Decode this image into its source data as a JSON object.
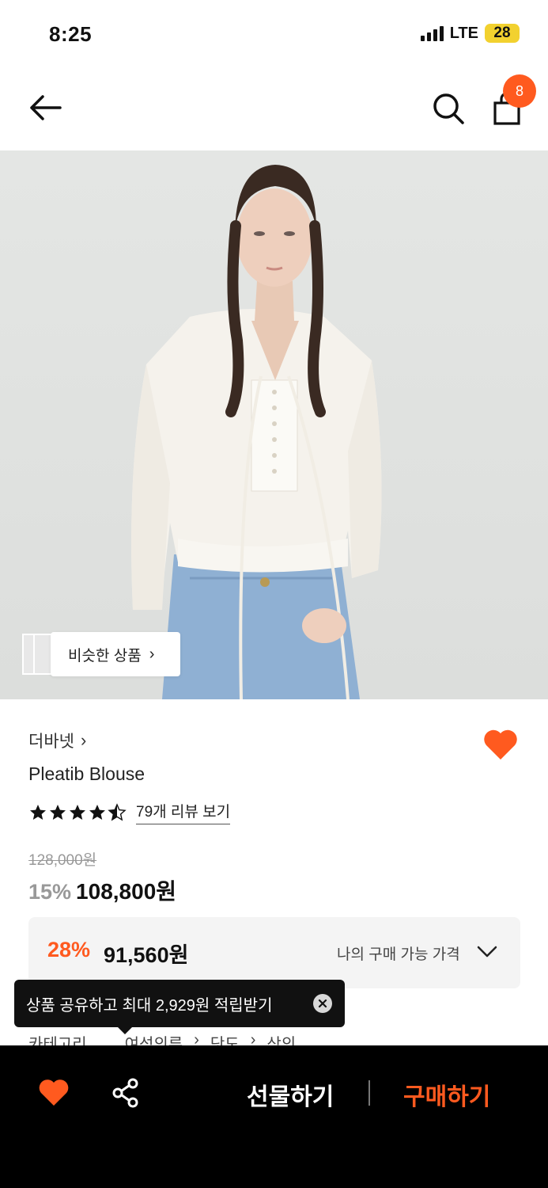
{
  "status_bar": {
    "time": "8:25",
    "network": "LTE",
    "battery": "28"
  },
  "nav": {
    "back_icon": "arrow-left-icon",
    "search_icon": "search-icon",
    "cart_icon": "shopping-bag-icon",
    "cart_count": "8"
  },
  "hero": {
    "similar_label": "비슷한 상품"
  },
  "product": {
    "brand": "더바넷",
    "name": "Pleatib Blouse",
    "rating": 4.5,
    "review_link": "79개 리뷰 보기",
    "original_price": "128,000원",
    "discount_pct": "15%",
    "sale_price": "108,800원",
    "liked": true
  },
  "my_price": {
    "pct": "28%",
    "price": "91,560원",
    "label": "나의 구매 가능 가격"
  },
  "tooltip": {
    "text": "상품 공유하고 최대 2,929원 적립받기"
  },
  "category": {
    "label": "카테고리",
    "path": [
      "여성의류",
      "닷도",
      "상의"
    ]
  },
  "bottom_bar": {
    "gift_label": "선물하기",
    "buy_label": "구매하기"
  },
  "colors": {
    "accent": "#ff5a1f",
    "bottom_bar": "#000000",
    "battery": "#f2d12f"
  }
}
